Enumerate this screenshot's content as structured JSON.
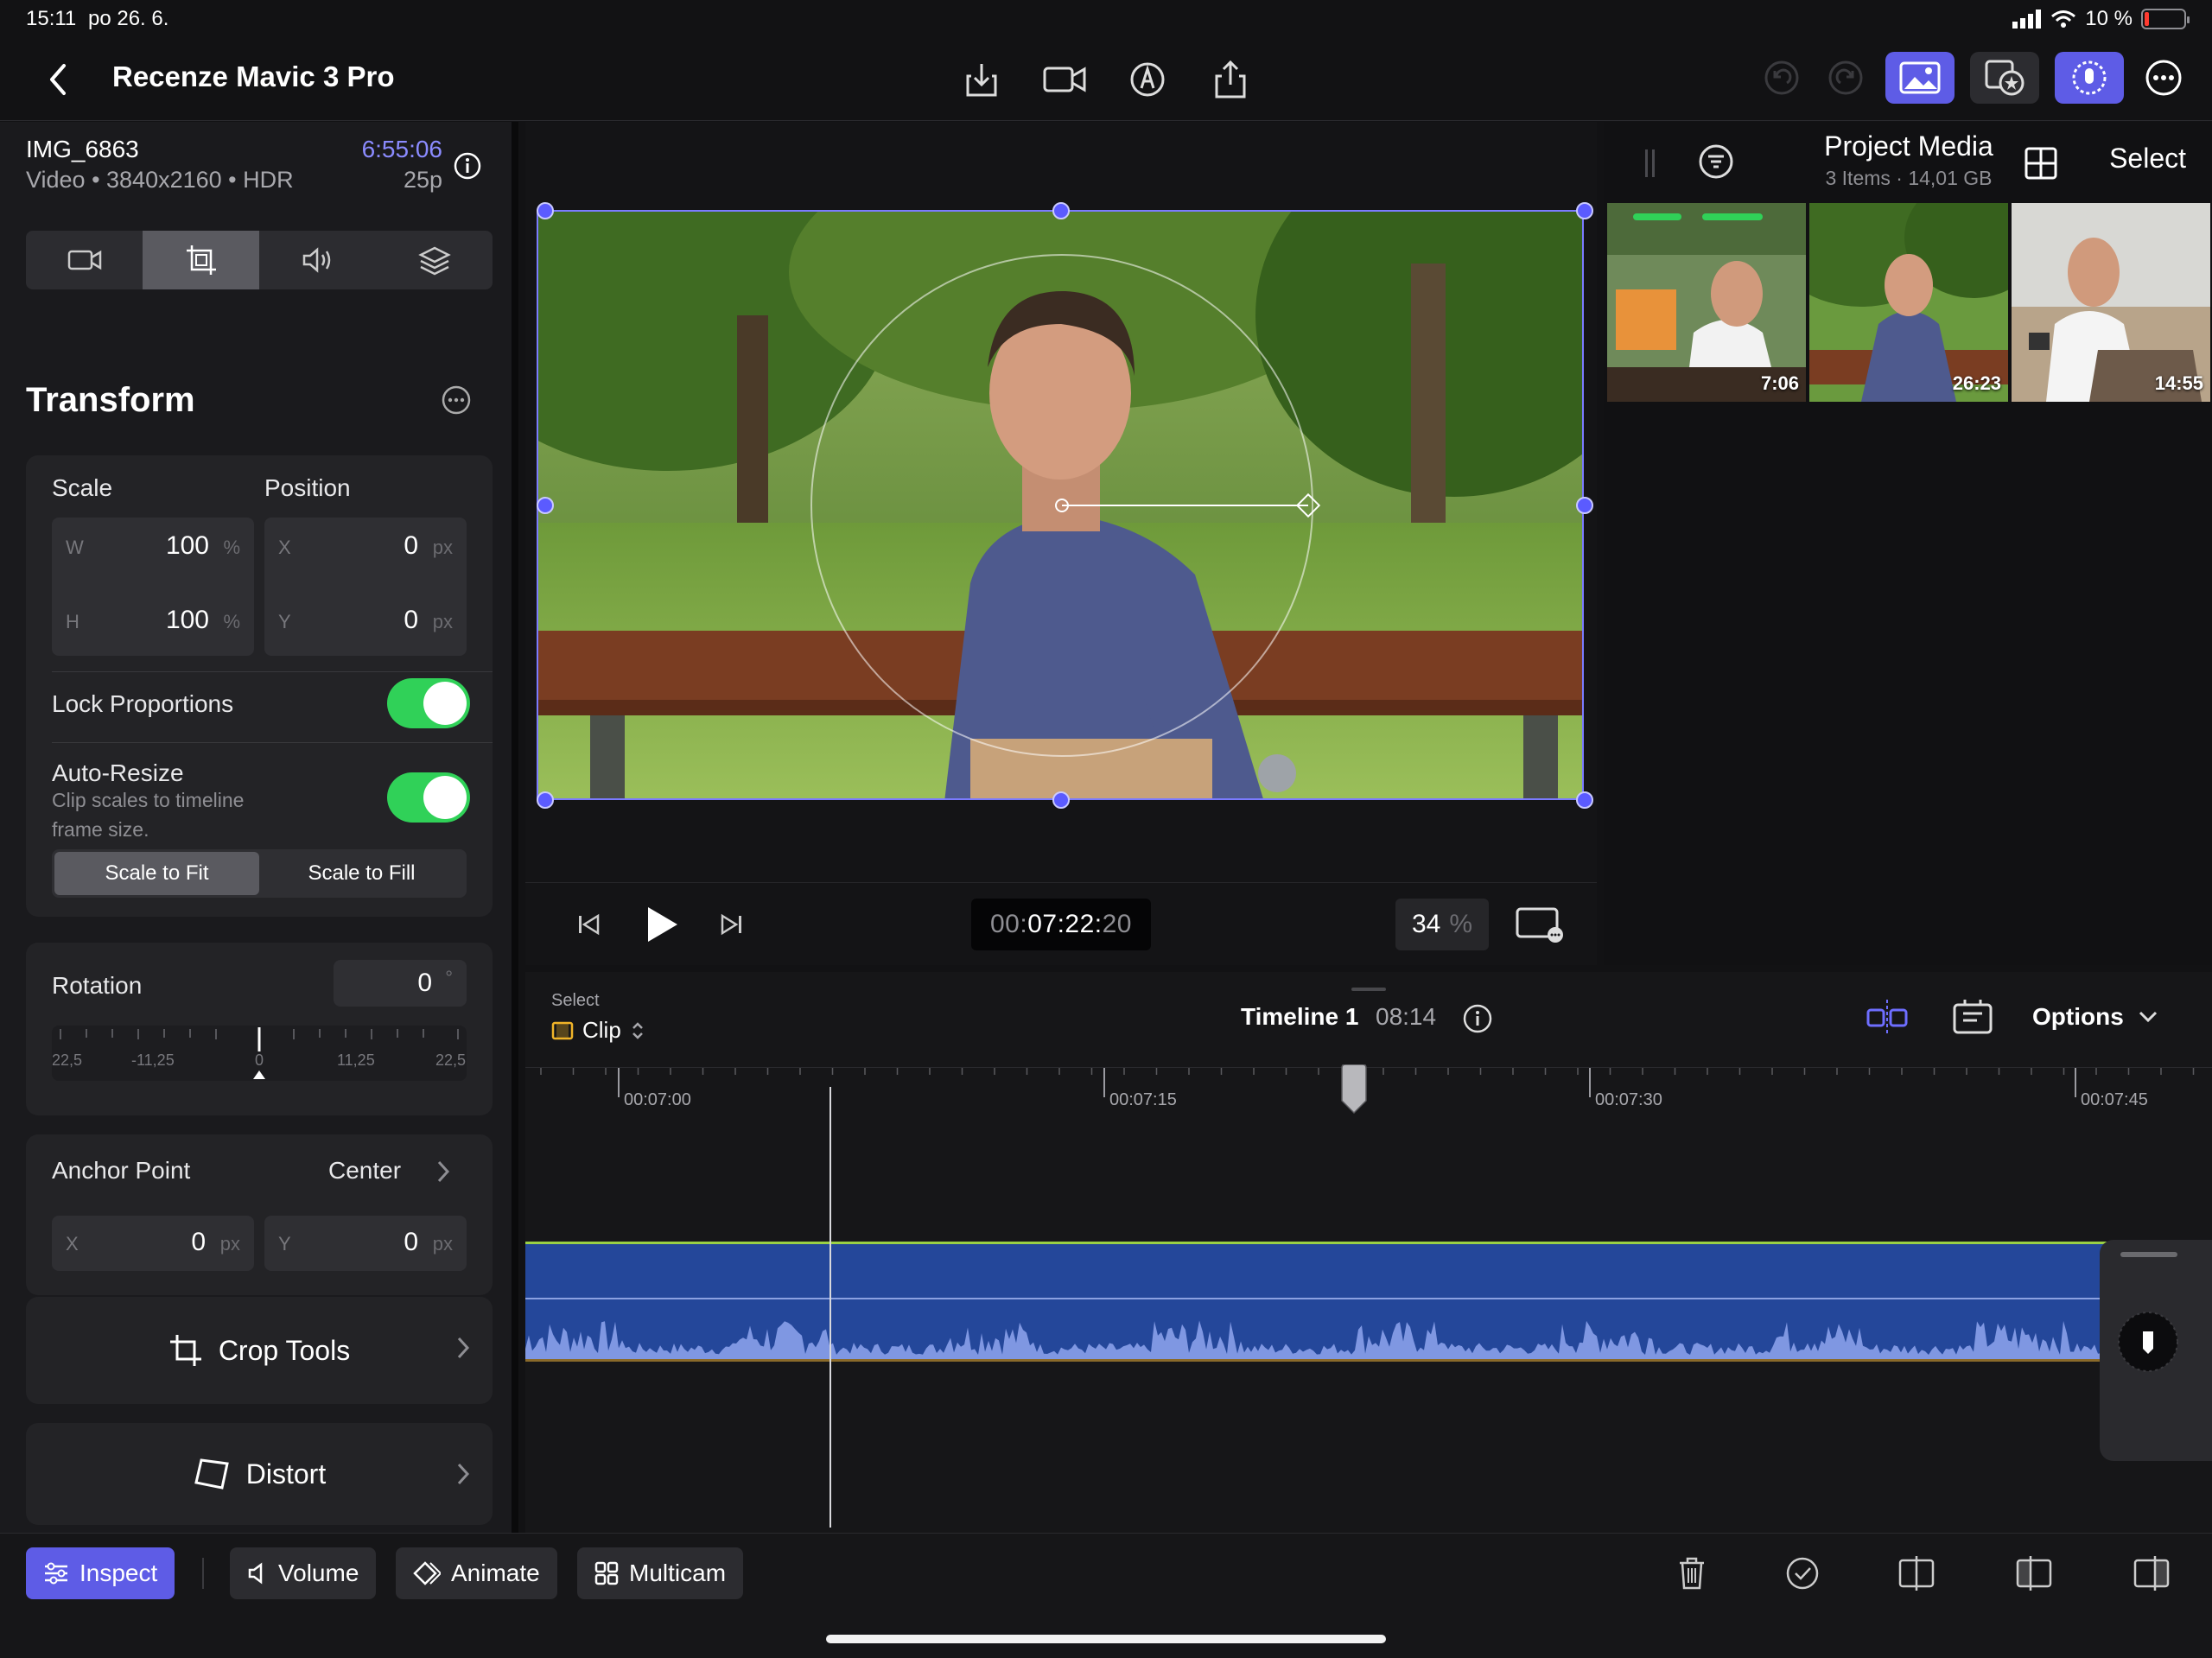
{
  "status_bar": {
    "time": "15:11",
    "date": "po 26. 6.",
    "battery": "10 %",
    "battery_level": 0.1
  },
  "nav": {
    "back_icon": "chevron-left-icon",
    "title": "Recenze Mavic 3 Pro"
  },
  "clip": {
    "name": "IMG_6863",
    "meta": "Video • 3840x2160 • HDR",
    "duration": "6:55:06",
    "fps": "25p"
  },
  "inspector_tabs": [
    "video-camera-icon",
    "transform-icon",
    "speaker-icon",
    "layers-icon"
  ],
  "transform": {
    "title": "Transform",
    "scale_label": "Scale",
    "position_label": "Position",
    "scale_w": {
      "key": "W",
      "value": "100",
      "unit": "%"
    },
    "scale_h": {
      "key": "H",
      "value": "100",
      "unit": "%"
    },
    "pos_x": {
      "key": "X",
      "value": "0",
      "unit": "px"
    },
    "pos_y": {
      "key": "Y",
      "value": "0",
      "unit": "px"
    },
    "lock_label": "Lock Proportions",
    "lock_on": true,
    "autoresize_label": "Auto-Resize",
    "autoresize_desc_1": "Clip scales to timeline",
    "autoresize_desc_2": "frame size.",
    "autoresize_on": true,
    "scale_to_fit": "Scale to Fit",
    "scale_to_fill": "Scale to Fill",
    "rotation_label": "Rotation",
    "rotation_value": "0",
    "rotation_unit": "°",
    "rotation_ticks": [
      "-22,5",
      "-11,25",
      "0",
      "11,25",
      "22,5"
    ],
    "anchor_label": "Anchor Point",
    "anchor_value": "Center",
    "anchor_x": {
      "key": "X",
      "value": "0",
      "unit": "px"
    },
    "anchor_y": {
      "key": "Y",
      "value": "0",
      "unit": "px"
    },
    "crop_tools": "Crop Tools",
    "distort": "Distort"
  },
  "viewer": {
    "timecode_dim": "00:",
    "timecode_main": "07:22:",
    "timecode_frames": "20",
    "zoom": "34",
    "zoom_unit": "%"
  },
  "browser": {
    "title": "Project Media",
    "subtitle": "3 Items  ·  14,01 GB",
    "select": "Select",
    "thumbs": [
      {
        "duration": "7:06"
      },
      {
        "duration": "26:23"
      },
      {
        "duration": "14:55"
      }
    ]
  },
  "timeline": {
    "select_label": "Select",
    "clip_label": "Clip",
    "title": "Timeline 1",
    "duration": "08:14",
    "options": "Options",
    "ruler": [
      "00:07:00",
      "00:07:15",
      "00:07:30",
      "00:07:45"
    ]
  },
  "toolbar": {
    "inspect": "Inspect",
    "volume": "Volume",
    "animate": "Animate",
    "multicam": "Multicam"
  },
  "colors": {
    "accent": "#5e5ce6",
    "toggle_on": "#30d158",
    "clip_blue": "#24479a",
    "timecode_blue": "#8b8bff"
  }
}
